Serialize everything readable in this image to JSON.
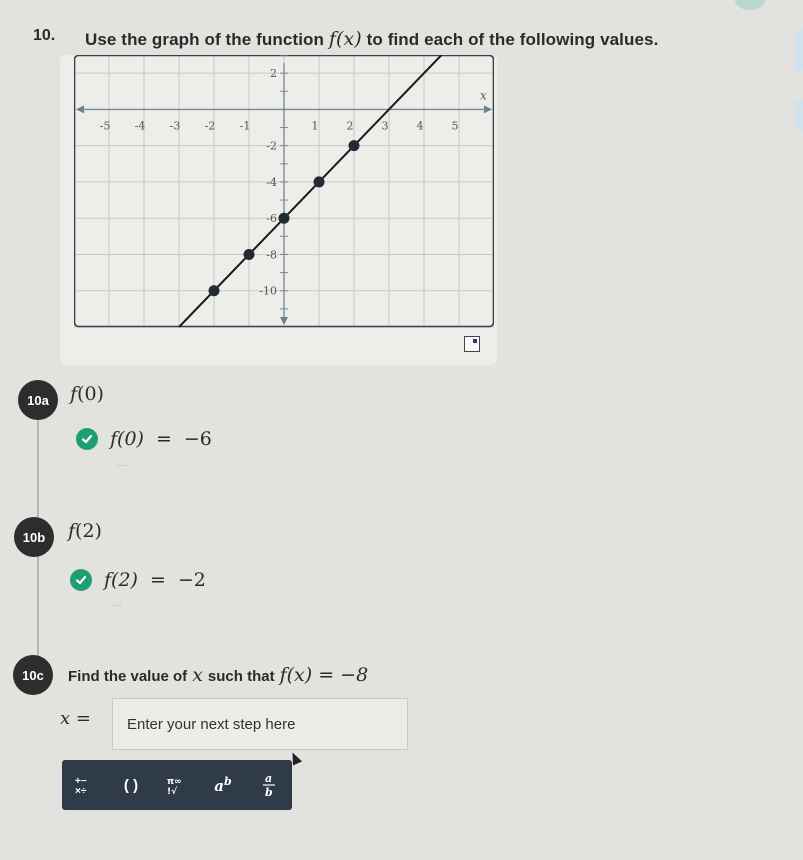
{
  "question": {
    "number": "10.",
    "text_before": "Use the graph of the function",
    "math": "f(x)",
    "text_after": "to find each of the following values."
  },
  "graph": {
    "x_axis_label": "x",
    "x_ticks": [
      "-5",
      "-4",
      "-3",
      "-2",
      "-1",
      "1",
      "2",
      "3",
      "4",
      "5"
    ],
    "y_ticks": [
      "2",
      "-2",
      "-4",
      "-6",
      "-8",
      "-10"
    ],
    "expand_icon": "expand-icon"
  },
  "chart_data": {
    "type": "line",
    "title": "",
    "xlabel": "x",
    "ylabel": "",
    "xlim": [
      -6,
      6
    ],
    "ylim": [
      -12,
      3
    ],
    "grid": true,
    "function": "f(x) = 2x - 6",
    "points": [
      {
        "x": -2,
        "y": -10
      },
      {
        "x": -1,
        "y": -8
      },
      {
        "x": 0,
        "y": -6
      },
      {
        "x": 1,
        "y": -4
      },
      {
        "x": 2,
        "y": -2
      }
    ],
    "line_endpoints": [
      {
        "x": -3,
        "y": -12
      },
      {
        "x": 4.5,
        "y": 3
      }
    ]
  },
  "parts": [
    {
      "badge": "10a",
      "prompt_fn": "f",
      "prompt_arg": "(0)",
      "answer_lhs": "f(0)",
      "answer_eq": "=",
      "answer_rhs": "−6",
      "status": "correct",
      "more": "…"
    },
    {
      "badge": "10b",
      "prompt_fn": "f",
      "prompt_arg": "(2)",
      "answer_lhs": "f(2)",
      "answer_eq": "=",
      "answer_rhs": "−2",
      "status": "correct",
      "more": "…"
    },
    {
      "badge": "10c",
      "prompt_text": "Find the value of",
      "prompt_var": "x",
      "prompt_text2": "such that",
      "prompt_math": "f(x) = −8",
      "input_label": "x =",
      "input_value": "",
      "input_placeholder": "Enter your next step here"
    }
  ],
  "toolbar": {
    "buttons": [
      {
        "label": "+−×÷",
        "icon": "operators-icon"
      },
      {
        "label": "( )",
        "icon": "parentheses-icon"
      },
      {
        "label": "π∞ !√",
        "icon": "symbols-icon"
      },
      {
        "label": "aᵇ",
        "icon": "exponent-icon"
      },
      {
        "label": "a/b",
        "icon": "fraction-icon"
      }
    ]
  },
  "colors": {
    "check": "#1f9e74",
    "badge": "#2d2d2d",
    "toolbar": "#2f3b48"
  }
}
